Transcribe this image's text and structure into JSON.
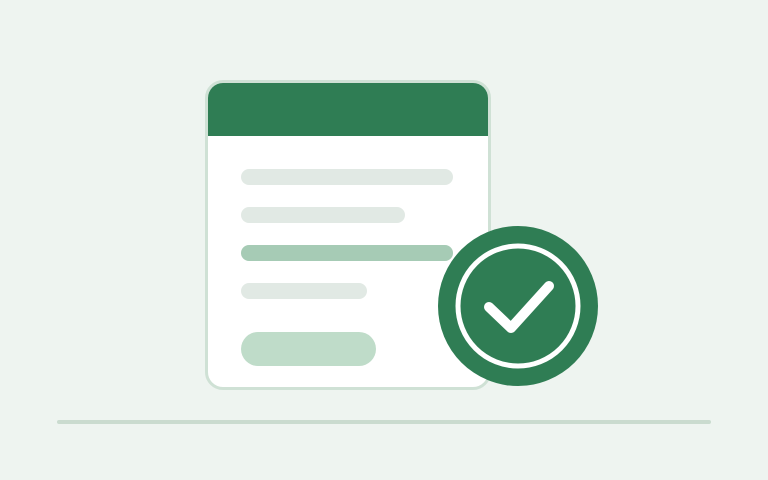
{
  "illustration": {
    "theme_colors": {
      "background": "#eef4f0",
      "brand_green": "#2f7d54",
      "window_border": "#cfe1d5",
      "placeholder_gray": "#e1e9e4",
      "highlight_green": "#a6cbb5",
      "button_green": "#bfdcc9",
      "baseline": "#cadbcf"
    },
    "icons": {
      "document": "form-document-icon",
      "status": "check-circle-icon"
    }
  }
}
